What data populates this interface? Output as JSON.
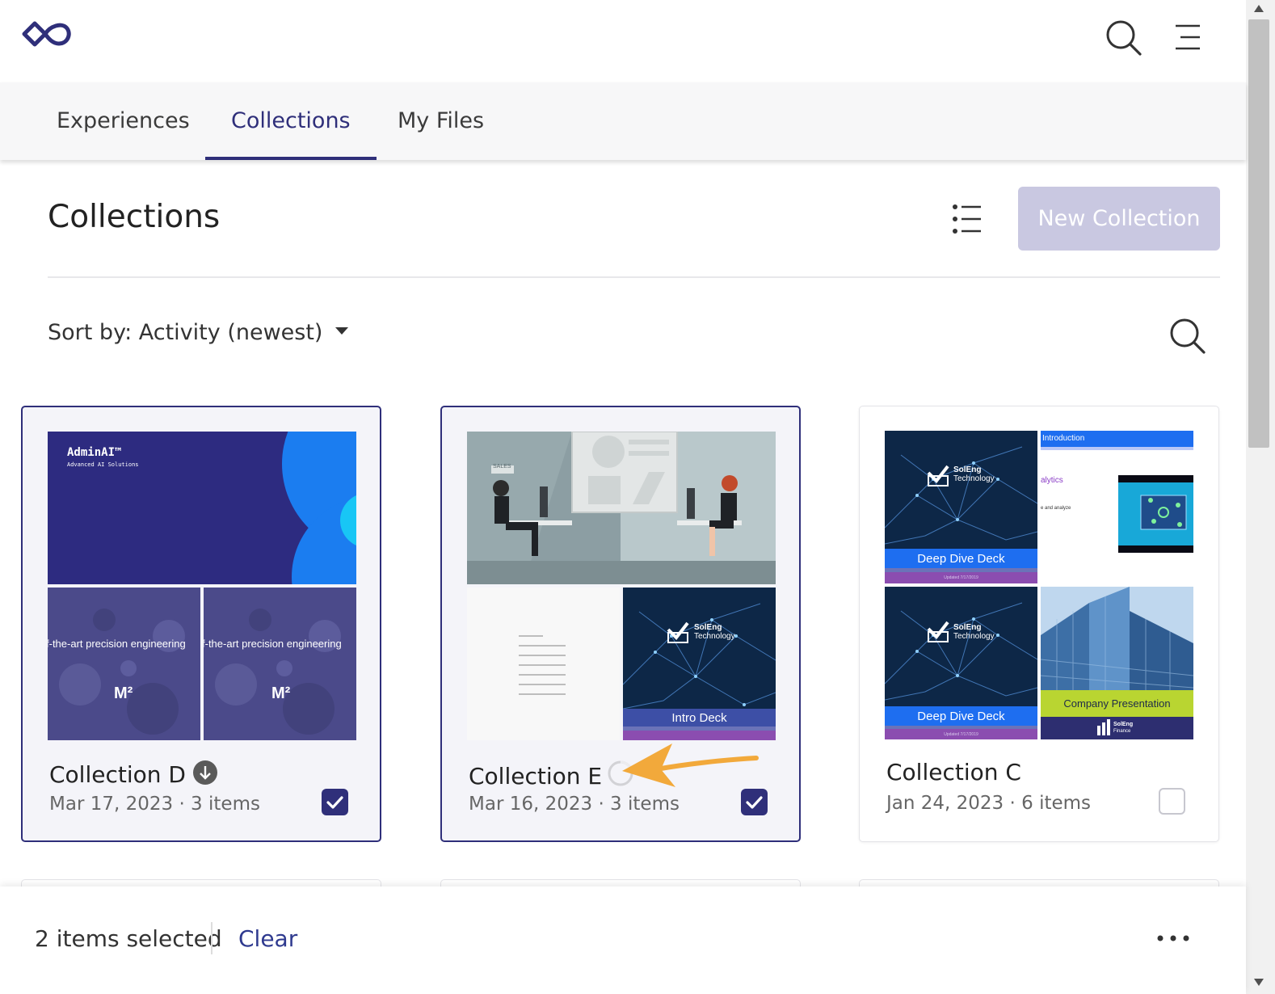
{
  "header": {
    "logo_icon": "infinity-logo-icon",
    "search_icon": "search-icon",
    "menu_icon": "hamburger-menu-icon"
  },
  "tabs": [
    {
      "label": "Experiences",
      "active": false
    },
    {
      "label": "Collections",
      "active": true
    },
    {
      "label": "My Files",
      "active": false
    }
  ],
  "page": {
    "title": "Collections",
    "new_button_label": "New Collection",
    "list_view_icon": "list-view-icon",
    "sort_label": "Sort by: Activity (newest)"
  },
  "cards": [
    {
      "title": "Collection D",
      "meta": "Mar 17, 2023 · 3 items",
      "selected": true,
      "status_icon": "download-icon",
      "thumbs": {
        "wide_title": "AdminAI™",
        "wide_subtitle": "Advanced AI Solutions",
        "bottom_text": "f-the-art precision engineering",
        "bottom_logo": "M²"
      }
    },
    {
      "title": "Collection E",
      "meta": "Mar 16, 2023 · 3 items",
      "selected": true,
      "status_icon": "loading-spinner-icon",
      "thumbs": {
        "sales_sign": "SALES",
        "brand_name": "SolEng",
        "brand_sub": "Technology",
        "deck_label": "Intro Deck"
      }
    },
    {
      "title": "Collection C",
      "meta": "Jan 24, 2023 · 6 items",
      "selected": false,
      "thumbs": {
        "brand_name": "SolEng",
        "brand_sub": "Technology",
        "deck_label": "Deep Dive Deck",
        "updated": "Updated 7/17/2019",
        "intro_header": "Introduction",
        "intro_word": "alytics",
        "intro_line": "e and analyze",
        "company_label": "Company Presentation",
        "finance_brand": "SolEng",
        "finance_sub": "Finance"
      }
    }
  ],
  "selection_bar": {
    "count_label": "2 items selected",
    "clear_label": "Clear",
    "more_icon": "more-options-icon"
  },
  "colors": {
    "accent": "#2f2f7a",
    "new_button_bg": "#c9c8e1",
    "selected_card_bg": "#f4f4f9",
    "annotation_arrow": "#f2a93b"
  }
}
